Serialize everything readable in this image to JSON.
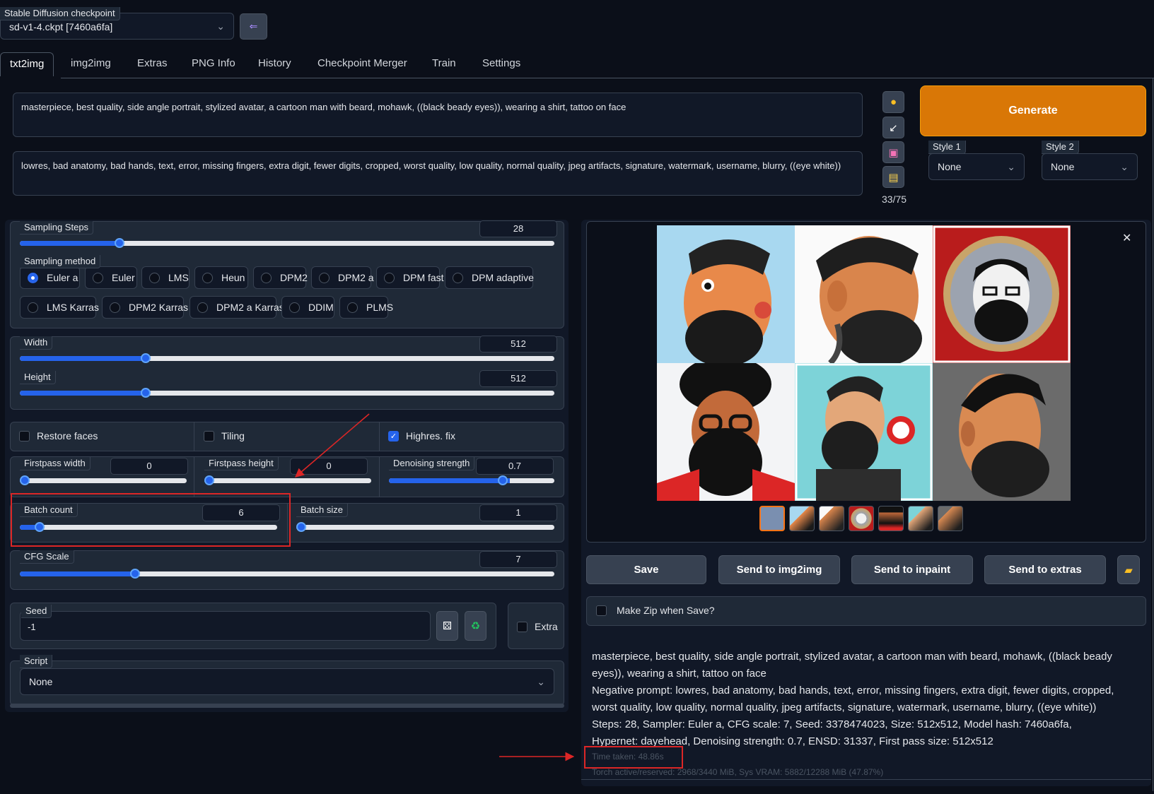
{
  "checkpoint": {
    "label": "Stable Diffusion checkpoint",
    "value": "sd-v1-4.ckpt [7460a6fa]"
  },
  "tabs": [
    "txt2img",
    "img2img",
    "Extras",
    "PNG Info",
    "History",
    "Checkpoint Merger",
    "Train",
    "Settings"
  ],
  "prompt": "masterpiece, best quality, side angle portrait, stylized avatar, a cartoon man with beard, mohawk, ((black beady eyes)), wearing a shirt, tattoo on face",
  "negative_prompt": "lowres, bad anatomy, bad hands, text, error, missing fingers, extra digit, fewer digits, cropped, worst quality, low quality, normal quality, jpeg artifacts, signature, watermark, username, blurry, ((eye white))",
  "token_count": "33/75",
  "generate_label": "Generate",
  "styles": {
    "style1_label": "Style 1",
    "style1_value": "None",
    "style2_label": "Style 2",
    "style2_value": "None"
  },
  "sampling_steps": {
    "label": "Sampling Steps",
    "value": "28",
    "fraction": 0.18
  },
  "sampling_method": {
    "label": "Sampling method",
    "row1": [
      "Euler a",
      "Euler",
      "LMS",
      "Heun",
      "DPM2",
      "DPM2 a",
      "DPM fast",
      "DPM adaptive"
    ],
    "row2": [
      "LMS Karras",
      "DPM2 Karras",
      "DPM2 a Karras",
      "DDIM",
      "PLMS"
    ],
    "selected": "Euler a"
  },
  "width": {
    "label": "Width",
    "value": "512",
    "fraction": 0.23
  },
  "height": {
    "label": "Height",
    "value": "512",
    "fraction": 0.23
  },
  "checkboxes": {
    "restore_faces": "Restore faces",
    "tiling": "Tiling",
    "highres_fix": "Highres. fix"
  },
  "firstpass_width": {
    "label": "Firstpass width",
    "value": "0",
    "fraction": 0.0
  },
  "firstpass_height": {
    "label": "Firstpass height",
    "value": "0",
    "fraction": 0.0
  },
  "denoising_strength": {
    "label": "Denoising strength",
    "value": "0.7",
    "fraction": 0.7
  },
  "batch_count": {
    "label": "Batch count",
    "value": "6",
    "fraction": 0.06
  },
  "batch_size": {
    "label": "Batch size",
    "value": "1",
    "fraction": 0.0
  },
  "cfg_scale": {
    "label": "CFG Scale",
    "value": "7",
    "fraction": 0.21
  },
  "seed": {
    "label": "Seed",
    "value": "-1",
    "extra_label": "Extra"
  },
  "script": {
    "label": "Script",
    "value": "None"
  },
  "output_buttons": {
    "save": "Save",
    "img2img": "Send to img2img",
    "inpaint": "Send to inpaint",
    "extras": "Send to extras"
  },
  "make_zip_label": "Make Zip when Save?",
  "info": {
    "prompt_line": "masterpiece, best quality, side angle portrait, stylized avatar, a cartoon man with beard, mohawk, ((black beady eyes)), wearing a shirt, tattoo on face",
    "negative_line": "Negative prompt: lowres, bad anatomy, bad hands, text, error, missing fingers, extra digit, fewer digits, cropped, worst quality, low quality, normal quality, jpeg artifacts, signature, watermark, username, blurry, ((eye white))",
    "params_line": "Steps: 28, Sampler: Euler a, CFG scale: 7, Seed: 3378474023, Size: 512x512, Model hash: 7460a6fa, Hypernet: dayehead, Denoising strength: 0.7, ENSD: 31337, First pass size: 512x512",
    "time_taken": "Time taken: 48.86s",
    "torch": "Torch active/reserved: 2968/3440 MiB, Sys VRAM: 5882/12288 MiB (47.87%)"
  },
  "colors": {
    "accent": "#2563eb",
    "generate": "#d97706",
    "background": "#0b0f19",
    "annotation_red": "#dc2626"
  },
  "icons": [
    "paint-palette-icon",
    "arrow-icon",
    "floppy-disk-icon",
    "clipboard-icon",
    "dice-icon",
    "recycle-icon",
    "folder-icon",
    "close-icon"
  ]
}
